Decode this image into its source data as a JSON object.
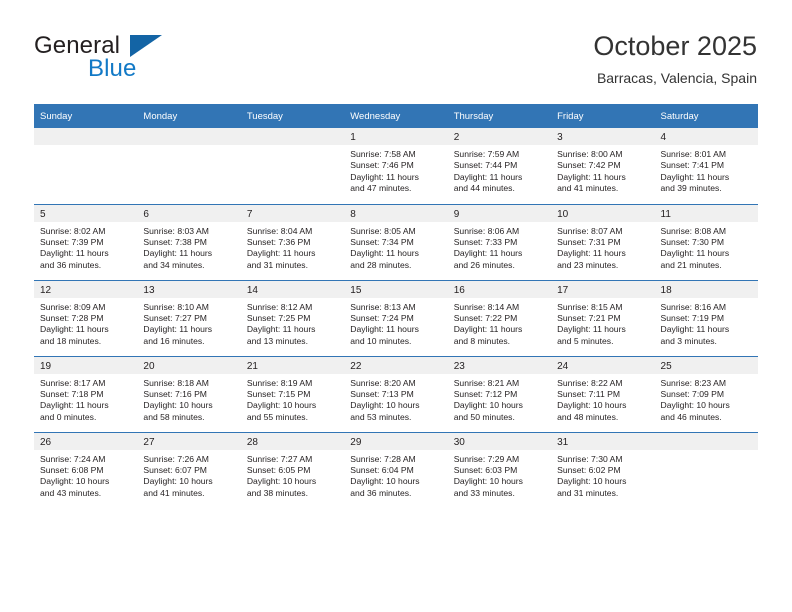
{
  "brand": {
    "name_top": "General",
    "name_bottom": "Blue",
    "triangle_icon": "triangle-icon",
    "accent_color": "#1279c6",
    "triangle_color": "#1364a5"
  },
  "header": {
    "title": "October 2025",
    "subtitle": "Barracas, Valencia, Spain"
  },
  "calendar": {
    "header_bg": "#3275b5",
    "header_text_color": "#ffffff",
    "daynum_band_bg": "#f0f0f0",
    "weekday_headers": [
      "Sunday",
      "Monday",
      "Tuesday",
      "Wednesday",
      "Thursday",
      "Friday",
      "Saturday"
    ],
    "weeks": [
      [
        {
          "day": "",
          "lines": []
        },
        {
          "day": "",
          "lines": []
        },
        {
          "day": "",
          "lines": []
        },
        {
          "day": "1",
          "lines": [
            "Sunrise: 7:58 AM",
            "Sunset: 7:46 PM",
            "Daylight: 11 hours",
            "and 47 minutes."
          ]
        },
        {
          "day": "2",
          "lines": [
            "Sunrise: 7:59 AM",
            "Sunset: 7:44 PM",
            "Daylight: 11 hours",
            "and 44 minutes."
          ]
        },
        {
          "day": "3",
          "lines": [
            "Sunrise: 8:00 AM",
            "Sunset: 7:42 PM",
            "Daylight: 11 hours",
            "and 41 minutes."
          ]
        },
        {
          "day": "4",
          "lines": [
            "Sunrise: 8:01 AM",
            "Sunset: 7:41 PM",
            "Daylight: 11 hours",
            "and 39 minutes."
          ]
        }
      ],
      [
        {
          "day": "5",
          "lines": [
            "Sunrise: 8:02 AM",
            "Sunset: 7:39 PM",
            "Daylight: 11 hours",
            "and 36 minutes."
          ]
        },
        {
          "day": "6",
          "lines": [
            "Sunrise: 8:03 AM",
            "Sunset: 7:38 PM",
            "Daylight: 11 hours",
            "and 34 minutes."
          ]
        },
        {
          "day": "7",
          "lines": [
            "Sunrise: 8:04 AM",
            "Sunset: 7:36 PM",
            "Daylight: 11 hours",
            "and 31 minutes."
          ]
        },
        {
          "day": "8",
          "lines": [
            "Sunrise: 8:05 AM",
            "Sunset: 7:34 PM",
            "Daylight: 11 hours",
            "and 28 minutes."
          ]
        },
        {
          "day": "9",
          "lines": [
            "Sunrise: 8:06 AM",
            "Sunset: 7:33 PM",
            "Daylight: 11 hours",
            "and 26 minutes."
          ]
        },
        {
          "day": "10",
          "lines": [
            "Sunrise: 8:07 AM",
            "Sunset: 7:31 PM",
            "Daylight: 11 hours",
            "and 23 minutes."
          ]
        },
        {
          "day": "11",
          "lines": [
            "Sunrise: 8:08 AM",
            "Sunset: 7:30 PM",
            "Daylight: 11 hours",
            "and 21 minutes."
          ]
        }
      ],
      [
        {
          "day": "12",
          "lines": [
            "Sunrise: 8:09 AM",
            "Sunset: 7:28 PM",
            "Daylight: 11 hours",
            "and 18 minutes."
          ]
        },
        {
          "day": "13",
          "lines": [
            "Sunrise: 8:10 AM",
            "Sunset: 7:27 PM",
            "Daylight: 11 hours",
            "and 16 minutes."
          ]
        },
        {
          "day": "14",
          "lines": [
            "Sunrise: 8:12 AM",
            "Sunset: 7:25 PM",
            "Daylight: 11 hours",
            "and 13 minutes."
          ]
        },
        {
          "day": "15",
          "lines": [
            "Sunrise: 8:13 AM",
            "Sunset: 7:24 PM",
            "Daylight: 11 hours",
            "and 10 minutes."
          ]
        },
        {
          "day": "16",
          "lines": [
            "Sunrise: 8:14 AM",
            "Sunset: 7:22 PM",
            "Daylight: 11 hours",
            "and 8 minutes."
          ]
        },
        {
          "day": "17",
          "lines": [
            "Sunrise: 8:15 AM",
            "Sunset: 7:21 PM",
            "Daylight: 11 hours",
            "and 5 minutes."
          ]
        },
        {
          "day": "18",
          "lines": [
            "Sunrise: 8:16 AM",
            "Sunset: 7:19 PM",
            "Daylight: 11 hours",
            "and 3 minutes."
          ]
        }
      ],
      [
        {
          "day": "19",
          "lines": [
            "Sunrise: 8:17 AM",
            "Sunset: 7:18 PM",
            "Daylight: 11 hours",
            "and 0 minutes."
          ]
        },
        {
          "day": "20",
          "lines": [
            "Sunrise: 8:18 AM",
            "Sunset: 7:16 PM",
            "Daylight: 10 hours",
            "and 58 minutes."
          ]
        },
        {
          "day": "21",
          "lines": [
            "Sunrise: 8:19 AM",
            "Sunset: 7:15 PM",
            "Daylight: 10 hours",
            "and 55 minutes."
          ]
        },
        {
          "day": "22",
          "lines": [
            "Sunrise: 8:20 AM",
            "Sunset: 7:13 PM",
            "Daylight: 10 hours",
            "and 53 minutes."
          ]
        },
        {
          "day": "23",
          "lines": [
            "Sunrise: 8:21 AM",
            "Sunset: 7:12 PM",
            "Daylight: 10 hours",
            "and 50 minutes."
          ]
        },
        {
          "day": "24",
          "lines": [
            "Sunrise: 8:22 AM",
            "Sunset: 7:11 PM",
            "Daylight: 10 hours",
            "and 48 minutes."
          ]
        },
        {
          "day": "25",
          "lines": [
            "Sunrise: 8:23 AM",
            "Sunset: 7:09 PM",
            "Daylight: 10 hours",
            "and 46 minutes."
          ]
        }
      ],
      [
        {
          "day": "26",
          "lines": [
            "Sunrise: 7:24 AM",
            "Sunset: 6:08 PM",
            "Daylight: 10 hours",
            "and 43 minutes."
          ]
        },
        {
          "day": "27",
          "lines": [
            "Sunrise: 7:26 AM",
            "Sunset: 6:07 PM",
            "Daylight: 10 hours",
            "and 41 minutes."
          ]
        },
        {
          "day": "28",
          "lines": [
            "Sunrise: 7:27 AM",
            "Sunset: 6:05 PM",
            "Daylight: 10 hours",
            "and 38 minutes."
          ]
        },
        {
          "day": "29",
          "lines": [
            "Sunrise: 7:28 AM",
            "Sunset: 6:04 PM",
            "Daylight: 10 hours",
            "and 36 minutes."
          ]
        },
        {
          "day": "30",
          "lines": [
            "Sunrise: 7:29 AM",
            "Sunset: 6:03 PM",
            "Daylight: 10 hours",
            "and 33 minutes."
          ]
        },
        {
          "day": "31",
          "lines": [
            "Sunrise: 7:30 AM",
            "Sunset: 6:02 PM",
            "Daylight: 10 hours",
            "and 31 minutes."
          ]
        },
        {
          "day": "",
          "lines": []
        }
      ]
    ]
  }
}
